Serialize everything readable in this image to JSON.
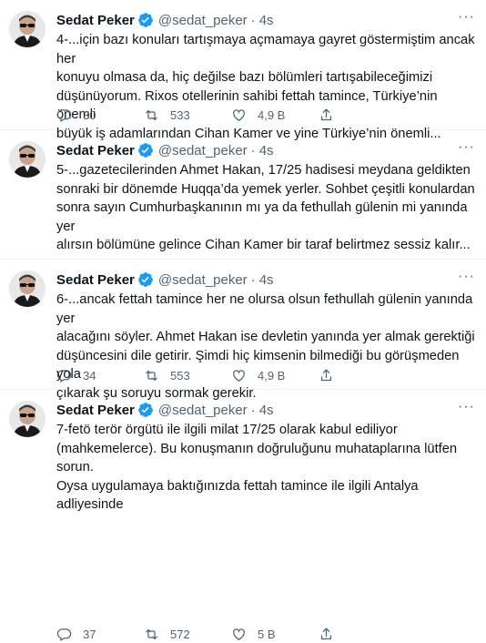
{
  "tweets": [
    {
      "name": "Sedat Peker",
      "handle": "@sedat_peker",
      "time": "4s",
      "lines": [
        "4-...için bazı konuları tartışmaya açmamaya gayret göstermiştim ancak her",
        "konuyu olmasa da, hiç değilse bazı bölümleri tartışabileceğimizi",
        "düşünüyorum. Rixos otellerinin sahibi fettah tamince, Türkiye’nin önemli",
        "büyük iş adamlarından Cihan Kamer ve yine Türkiye’nin önemli..."
      ],
      "replies": "30",
      "retweets": "533",
      "likes": "4,9 B"
    },
    {
      "name": "Sedat Peker",
      "handle": "@sedat_peker",
      "time": "4s",
      "lines": [
        "5-...gazetecilerinden Ahmet Hakan, 17/25 hadisesi meydana geldikten",
        "sonraki bir dönemde Huqqa’da yemek yerler. Sohbet çeşitli konulardan",
        "sonra sayın Cumhurbaşkanının mı ya da fethullah gülenin mi yanında yer",
        "alırsın bölümüne gelince Cihan Kamer bir taraf belirtmez sessiz kalır..."
      ],
      "replies": "34",
      "retweets": "553",
      "likes": "4,9 B"
    },
    {
      "name": "Sedat Peker",
      "handle": "@sedat_peker",
      "time": "4s",
      "lines": [
        "6-...ancak fettah tamince her ne olursa olsun fethullah gülenin yanında yer",
        "alacağını söyler. Ahmet Hakan ise devletin yanında yer almak gerektiği",
        "düşüncesini dile getirir. Şimdi hiç kimsenin bilmediği bu görüşmeden yola",
        "çıkarak şu soruyu sormak gerekir."
      ],
      "replies": "37",
      "retweets": "572",
      "likes": "5 B"
    },
    {
      "name": "Sedat Peker",
      "handle": "@sedat_peker",
      "time": "4s",
      "lines": [
        "7-fetö terör örgütü ile ilgili milat 17/25 olarak kabul ediliyor",
        "(mahkemelerce). Bu konuşmanın doğruluğunu muhataplarına lütfen sorun.",
        "Oysa uygulamaya baktığınızda fettah tamince ile ilgili Antalya adliyesinde"
      ],
      "replies": "",
      "retweets": "",
      "likes": ""
    }
  ],
  "icons": {
    "verified_color": "#1d9bf0",
    "reply": "reply-icon",
    "retweet": "retweet-icon",
    "like": "like-icon",
    "share": "share-icon",
    "more": "more-icon"
  }
}
